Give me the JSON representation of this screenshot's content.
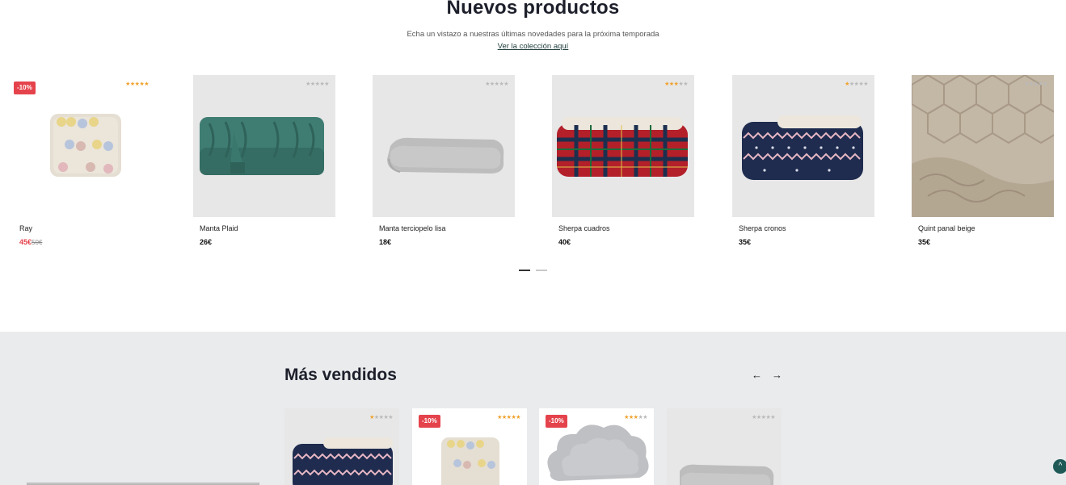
{
  "new_products": {
    "title": "Nuevos productos",
    "subtitle": "Echa un vistazo a nuestras últimas novedades para la próxima temporada",
    "link": "Ver la colección aquí",
    "items": [
      {
        "name": "Ray",
        "price": "45€",
        "old_price": "50€",
        "badge": "-10%",
        "rating": 5
      },
      {
        "name": "Manta Plaid",
        "price": "26€",
        "rating": 0
      },
      {
        "name": "Manta terciopelo lisa",
        "price": "18€",
        "rating": 0
      },
      {
        "name": "Sherpa cuadros",
        "price": "40€",
        "rating": 3
      },
      {
        "name": "Sherpa cronos",
        "price": "35€",
        "rating": 1
      },
      {
        "name": "Quint panal beige",
        "price": "35€",
        "rating": 0
      }
    ]
  },
  "best_sellers": {
    "title": "Más vendidos",
    "prev_icon": "←",
    "next_icon": "→",
    "items": [
      {
        "rating": 1
      },
      {
        "badge": "-10%",
        "rating": 5
      },
      {
        "badge": "-10%",
        "rating": 3
      },
      {
        "rating": 0
      }
    ]
  },
  "scroll_top_icon": "^",
  "colors": {
    "accent": "#1f5a57",
    "sale": "#e5434c",
    "star": "#f0a12b",
    "section_bg": "#e9ebed"
  }
}
